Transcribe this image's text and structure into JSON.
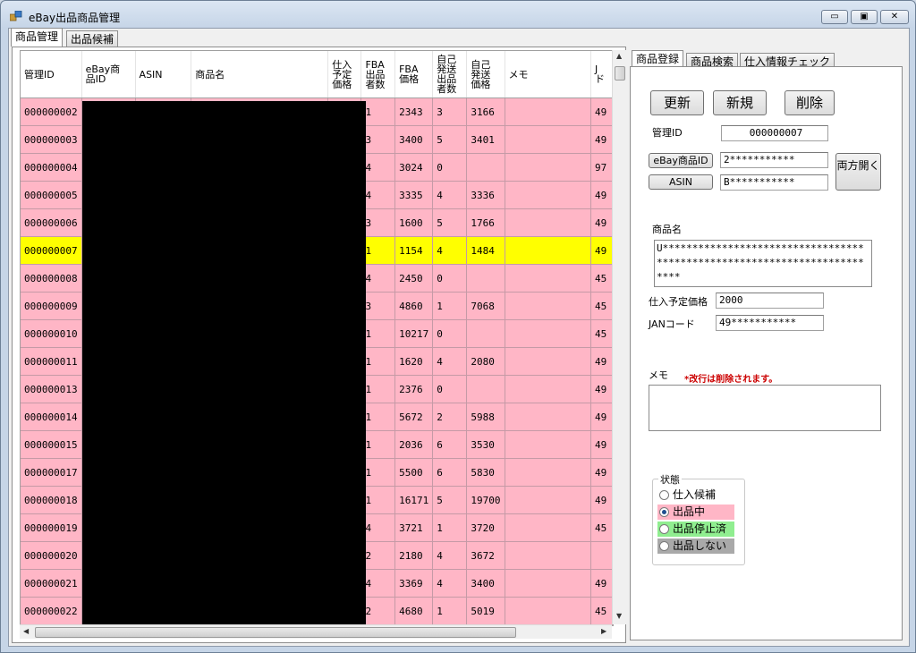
{
  "window": {
    "title": "eBay出品商品管理",
    "minimize": "▭",
    "maximize": "▣",
    "close": "✕"
  },
  "main_tabs": [
    {
      "label": "商品管理",
      "active": true
    },
    {
      "label": "出品候補",
      "active": false
    }
  ],
  "grid": {
    "columns": [
      "管理ID",
      "eBay商品ID",
      "ASIN",
      "商品名",
      "仕入予定価格",
      "FBA出品者数",
      "FBA価格",
      "自己発送出品者数",
      "自己発送価格",
      "メモ",
      "JANコード"
    ],
    "column_display": [
      "管理ID",
      "eBay商\n品ID",
      "ASIN",
      "商品名",
      "仕入\n予定\n価格",
      "FBA\n出品\n者数",
      "FBA\n価格",
      "自己\n発送\n出品\n者数",
      "自己\n発送\n価格",
      "メモ",
      "J\nド"
    ],
    "rows": [
      {
        "id": "000000002",
        "fba_sellers": "1",
        "fba_price": "2343",
        "self_sellers": "3",
        "self_price": "3166",
        "memo": "",
        "jan": "49"
      },
      {
        "id": "000000003",
        "fba_sellers": "3",
        "fba_price": "3400",
        "self_sellers": "5",
        "self_price": "3401",
        "memo": "",
        "jan": "49"
      },
      {
        "id": "000000004",
        "fba_sellers": "4",
        "fba_price": "3024",
        "self_sellers": "0",
        "self_price": "",
        "memo": "",
        "jan": "97"
      },
      {
        "id": "000000005",
        "fba_sellers": "4",
        "fba_price": "3335",
        "self_sellers": "4",
        "self_price": "3336",
        "memo": "",
        "jan": "49"
      },
      {
        "id": "000000006",
        "fba_sellers": "3",
        "fba_price": "1600",
        "self_sellers": "5",
        "self_price": "1766",
        "memo": "",
        "jan": "49"
      },
      {
        "id": "000000007",
        "fba_sellers": "1",
        "fba_price": "1154",
        "self_sellers": "4",
        "self_price": "1484",
        "memo": "",
        "jan": "49",
        "selected": true
      },
      {
        "id": "000000008",
        "fba_sellers": "4",
        "fba_price": "2450",
        "self_sellers": "0",
        "self_price": "",
        "memo": "",
        "jan": "45"
      },
      {
        "id": "000000009",
        "fba_sellers": "3",
        "fba_price": "4860",
        "self_sellers": "1",
        "self_price": "7068",
        "memo": "",
        "jan": "45"
      },
      {
        "id": "000000010",
        "fba_sellers": "1",
        "fba_price": "10217",
        "self_sellers": "0",
        "self_price": "",
        "memo": "",
        "jan": "45"
      },
      {
        "id": "000000011",
        "fba_sellers": "1",
        "fba_price": "1620",
        "self_sellers": "4",
        "self_price": "2080",
        "memo": "",
        "jan": "49"
      },
      {
        "id": "000000013",
        "fba_sellers": "1",
        "fba_price": "2376",
        "self_sellers": "0",
        "self_price": "",
        "memo": "",
        "jan": "49"
      },
      {
        "id": "000000014",
        "fba_sellers": "1",
        "fba_price": "5672",
        "self_sellers": "2",
        "self_price": "5988",
        "memo": "",
        "jan": "49"
      },
      {
        "id": "000000015",
        "fba_sellers": "1",
        "fba_price": "2036",
        "self_sellers": "6",
        "self_price": "3530",
        "memo": "",
        "jan": "49"
      },
      {
        "id": "000000017",
        "fba_sellers": "1",
        "fba_price": "5500",
        "self_sellers": "6",
        "self_price": "5830",
        "memo": "",
        "jan": "49"
      },
      {
        "id": "000000018",
        "fba_sellers": "1",
        "fba_price": "16171",
        "self_sellers": "5",
        "self_price": "19700",
        "memo": "",
        "jan": "49"
      },
      {
        "id": "000000019",
        "fba_sellers": "4",
        "fba_price": "3721",
        "self_sellers": "1",
        "self_price": "3720",
        "memo": "",
        "jan": "45"
      },
      {
        "id": "000000020",
        "fba_sellers": "2",
        "fba_price": "2180",
        "self_sellers": "4",
        "self_price": "3672",
        "memo": "",
        "jan": ""
      },
      {
        "id": "000000021",
        "fba_sellers": "4",
        "fba_price": "3369",
        "self_sellers": "4",
        "self_price": "3400",
        "memo": "",
        "jan": "49"
      },
      {
        "id": "000000022",
        "fba_sellers": "2",
        "fba_price": "4680",
        "self_sellers": "1",
        "self_price": "5019",
        "memo": "",
        "jan": "45"
      }
    ]
  },
  "right_tabs": [
    {
      "label": "商品登録",
      "active": true
    },
    {
      "label": "商品検索",
      "active": false
    },
    {
      "label": "仕入情報チェック",
      "active": false
    }
  ],
  "form": {
    "update_button": "更新",
    "new_button": "新規",
    "delete_button": "削除",
    "id_label": "管理ID",
    "id_value": "000000007",
    "ebay_id_button": "eBay商品ID",
    "ebay_id_value": "2***********",
    "asin_button": "ASIN",
    "asin_value": "B***********",
    "open_both_button": "両方開く",
    "name_label": "商品名",
    "name_value": "U*************************************************************************",
    "purchase_price_label": "仕入予定価格",
    "purchase_price_value": "2000",
    "jan_label": "JANコード",
    "jan_value": "49***********",
    "memo_label": "メモ",
    "memo_note": "*改行は削除されます。",
    "memo_value": "",
    "memo_note_color": "#cc0000"
  },
  "status": {
    "title": "状態",
    "options": [
      {
        "label": "仕入候補",
        "color": "#ffffff",
        "checked": false
      },
      {
        "label": "出品中",
        "color": "#ffb6c6",
        "checked": true
      },
      {
        "label": "出品停止済",
        "color": "#90ee90",
        "checked": false
      },
      {
        "label": "出品しない",
        "color": "#a9a9a9",
        "checked": false
      }
    ]
  }
}
